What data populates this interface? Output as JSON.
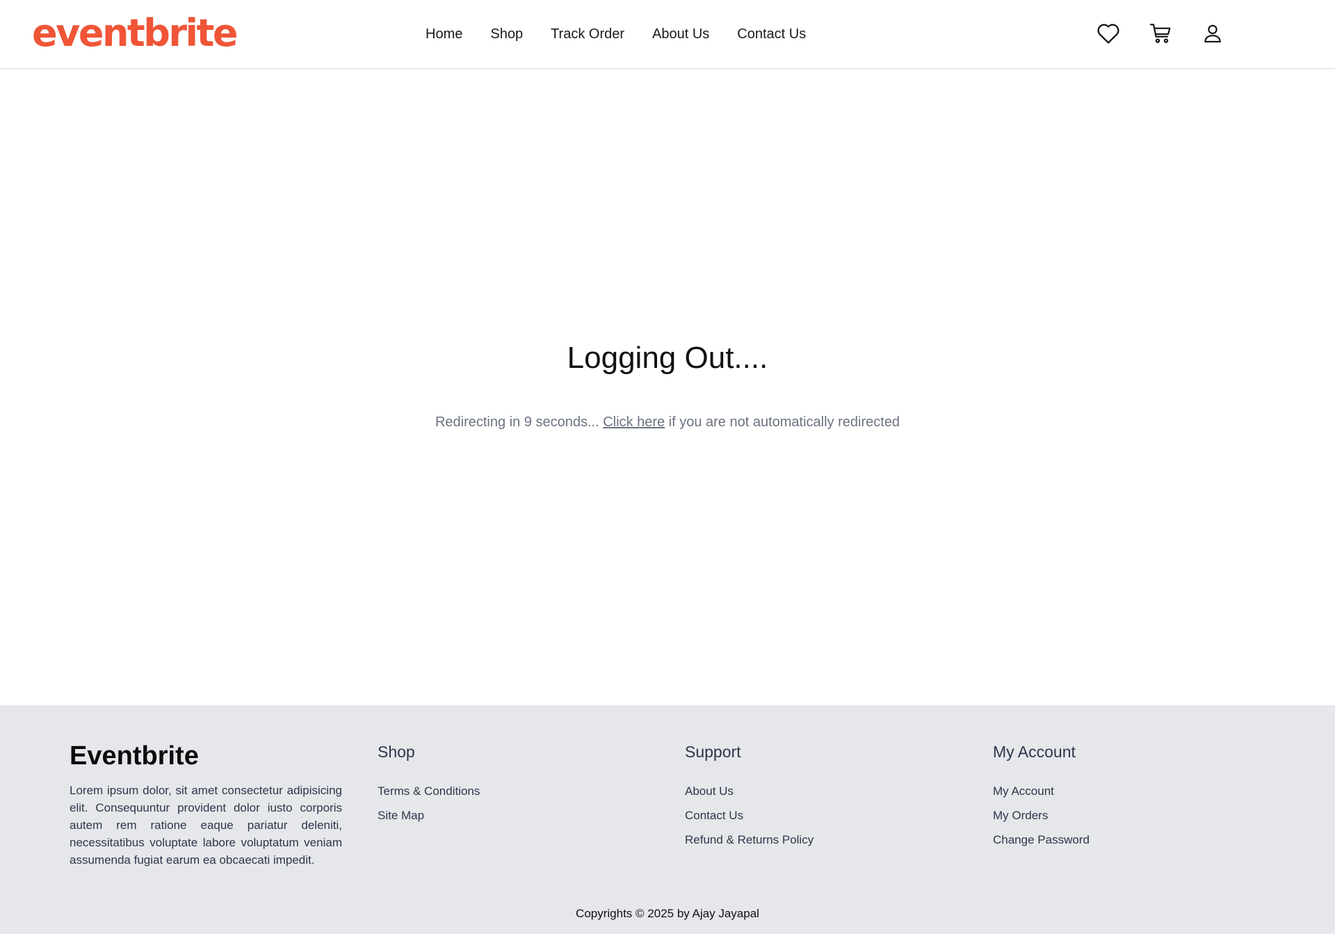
{
  "header": {
    "logo": "eventbrite",
    "nav": [
      {
        "label": "Home"
      },
      {
        "label": "Shop"
      },
      {
        "label": "Track Order"
      },
      {
        "label": "About Us"
      },
      {
        "label": "Contact Us"
      }
    ],
    "icons": [
      "heart-icon",
      "cart-icon",
      "user-icon"
    ]
  },
  "main": {
    "title": "Logging Out....",
    "redirect_prefix": "Redirecting in 9 seconds... ",
    "redirect_link": "Click here",
    "redirect_suffix": " if you are not automatically redirected"
  },
  "footer": {
    "brand": "Eventbrite",
    "about": "Lorem ipsum dolor, sit amet consectetur adipisicing elit. Consequuntur provident dolor iusto corporis autem rem ratione eaque pariatur deleniti, necessitatibus voluptate labore voluptatum veniam assumenda fugiat earum ea obcaecati impedit.",
    "shop": {
      "heading": "Shop",
      "links": [
        "Terms & Conditions",
        "Site Map"
      ]
    },
    "support": {
      "heading": "Support",
      "links": [
        "About Us",
        "Contact Us",
        "Refund & Returns Policy"
      ]
    },
    "account": {
      "heading": "My Account",
      "links": [
        "My Account",
        "My Orders",
        "Change Password"
      ]
    },
    "copyright": "Copyrights © 2025 by Ajay Jayapal"
  },
  "colors": {
    "brand": "#f05537",
    "footer_bg": "#e5e7eb",
    "muted_text": "#6b7280"
  }
}
